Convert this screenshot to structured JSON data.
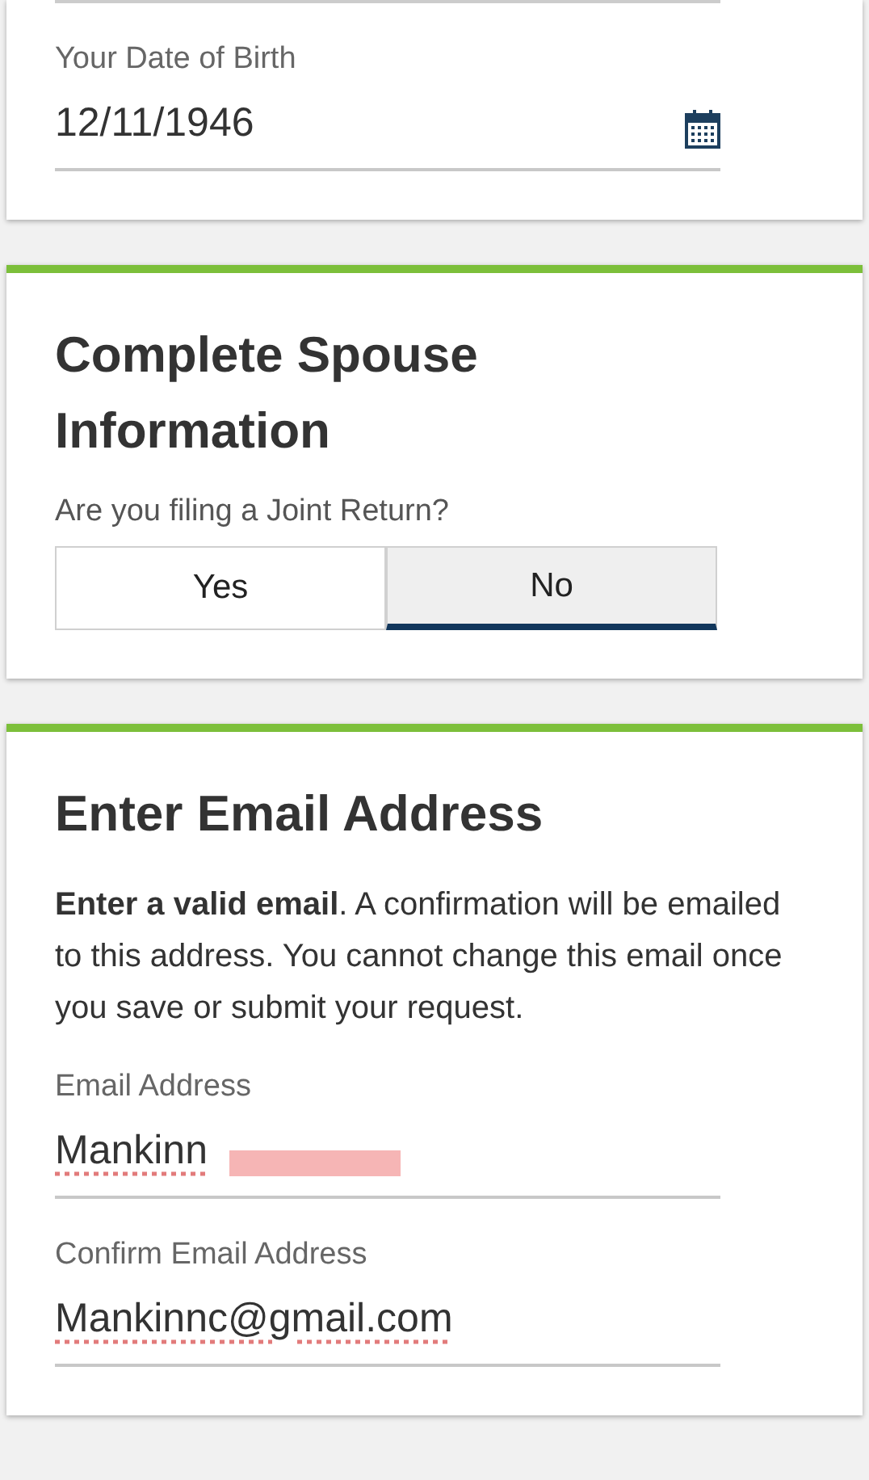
{
  "birth_card": {
    "label": "Your Date of Birth",
    "value": "12/11/1946"
  },
  "spouse_card": {
    "title": "Complete Spouse Information",
    "question": "Are you filing a Joint Return?",
    "options": [
      {
        "label": "Yes",
        "selected": false
      },
      {
        "label": "No",
        "selected": true
      }
    ]
  },
  "email_card": {
    "title": "Enter Email Address",
    "instructions": "**Enter a valid email**. A confirmation will be emailed to this address. You cannot change this email once you save or submit your request.",
    "fields": [
      {
        "label": "Email Address",
        "value": "Mankinn",
        "misspelled": true,
        "redacted": true
      },
      {
        "label": "Confirm Email Address",
        "value": "Mankinnc@gmail.com",
        "misspelled": true,
        "redacted": false
      }
    ]
  }
}
